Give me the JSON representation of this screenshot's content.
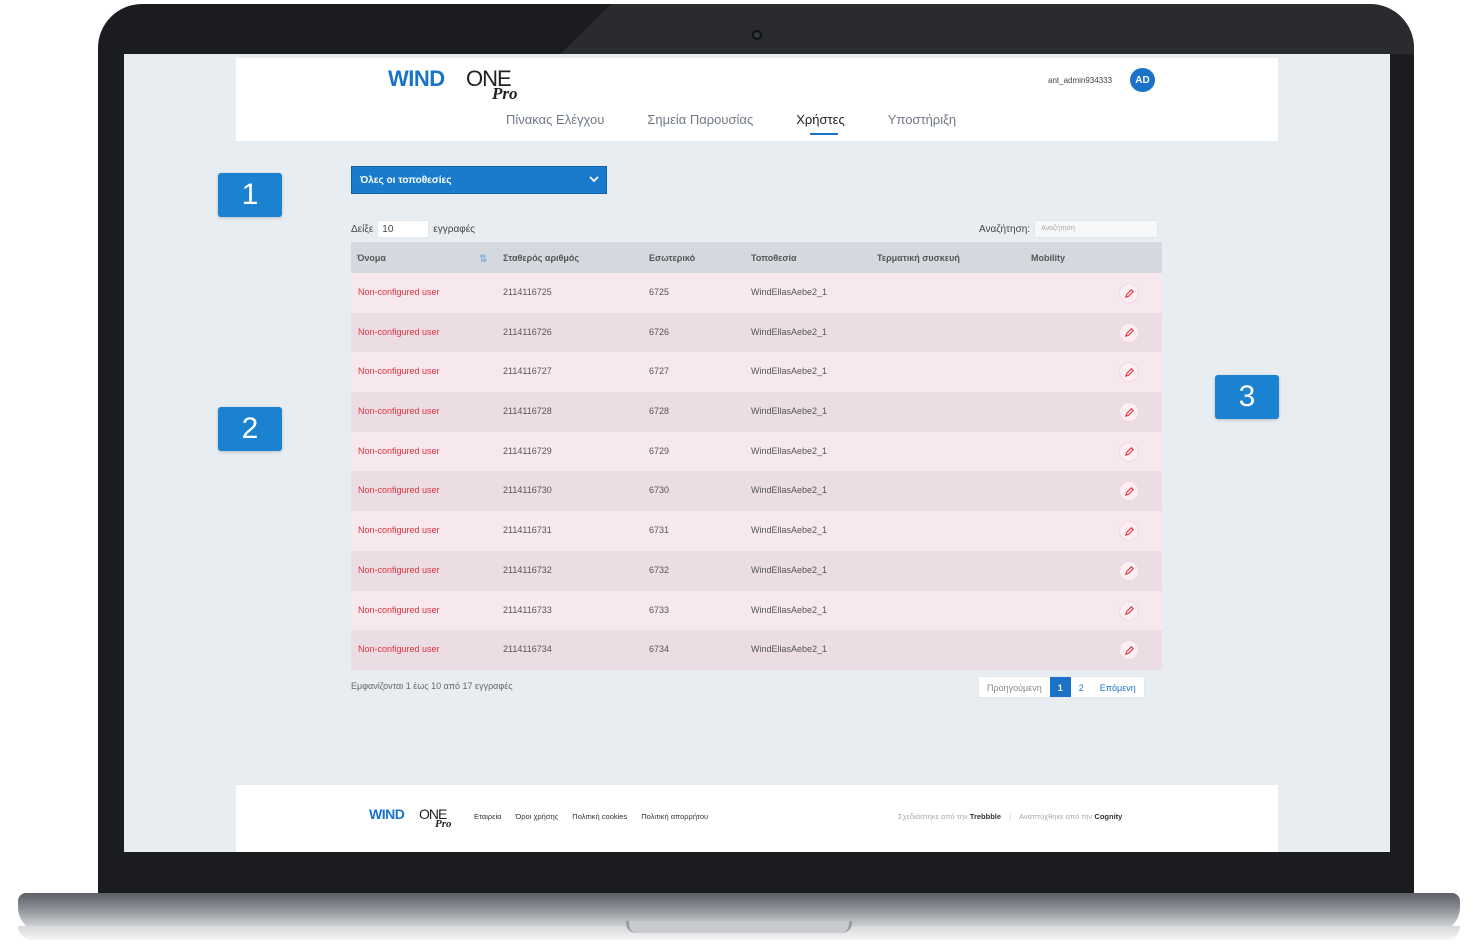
{
  "brand": {
    "wind": "WIND",
    "one": "ONE",
    "pro": "Pro"
  },
  "header": {
    "user_name": "ant_admin934333",
    "avatar_initials": "AD",
    "nav": [
      {
        "label": "Πίνακας Ελέγχου",
        "active": false
      },
      {
        "label": "Σημεία Παρουσίας",
        "active": false
      },
      {
        "label": "Χρήστες",
        "active": true
      },
      {
        "label": "Υποστήριξη",
        "active": false
      }
    ]
  },
  "location_select": {
    "value": "Όλες οι τοποθεσίες",
    "icon": "chevron-down-icon"
  },
  "length": {
    "prefix": "Δείξε",
    "value": "10",
    "suffix": "εγγραφές"
  },
  "search": {
    "label": "Αναζήτηση:",
    "placeholder": "Αναζήτηση"
  },
  "table": {
    "columns": [
      "Όνομα",
      "Σταθερός αριθμός",
      "Εσωτερικό",
      "Τοποθεσία",
      "Τερματική συσκευή",
      "Mobility"
    ],
    "rows": [
      {
        "name": "Non-configured user",
        "number": "2114116725",
        "ext": "6725",
        "location": "WindEllasAebe2_1"
      },
      {
        "name": "Non-configured user",
        "number": "2114116726",
        "ext": "6726",
        "location": "WindEllasAebe2_1"
      },
      {
        "name": "Non-configured user",
        "number": "2114116727",
        "ext": "6727",
        "location": "WindEllasAebe2_1"
      },
      {
        "name": "Non-configured user",
        "number": "2114116728",
        "ext": "6728",
        "location": "WindEllasAebe2_1"
      },
      {
        "name": "Non-configured user",
        "number": "2114116729",
        "ext": "6729",
        "location": "WindEllasAebe2_1"
      },
      {
        "name": "Non-configured user",
        "number": "2114116730",
        "ext": "6730",
        "location": "WindEllasAebe2_1"
      },
      {
        "name": "Non-configured user",
        "number": "2114116731",
        "ext": "6731",
        "location": "WindEllasAebe2_1"
      },
      {
        "name": "Non-configured user",
        "number": "2114116732",
        "ext": "6732",
        "location": "WindEllasAebe2_1"
      },
      {
        "name": "Non-configured user",
        "number": "2114116733",
        "ext": "6733",
        "location": "WindEllasAebe2_1"
      },
      {
        "name": "Non-configured user",
        "number": "2114116734",
        "ext": "6734",
        "location": "WindEllasAebe2_1"
      }
    ]
  },
  "info": "Εμφανίζονται 1 έως 10 από 17 εγγραφές",
  "pagination": {
    "prev": "Προηγούμενη",
    "pages": [
      "1",
      "2"
    ],
    "current": "1",
    "next": "Επόμενη"
  },
  "footer": {
    "links": [
      "Εταιρεία",
      "Όροι χρήσης",
      "Πολιτική cookies",
      "Πολιτική απορρήτου"
    ],
    "designed_prefix": "Σχεδιάστηκε από την",
    "designed_by": "Trebbble",
    "developed_prefix": "Αναπτύχθηκε από την",
    "developed_by": "Cognity"
  },
  "callouts": [
    "1",
    "2",
    "3"
  ],
  "colors": {
    "accent": "#1a73c9",
    "name_red": "#e0323d",
    "row_pink": "#f7e8ed"
  }
}
